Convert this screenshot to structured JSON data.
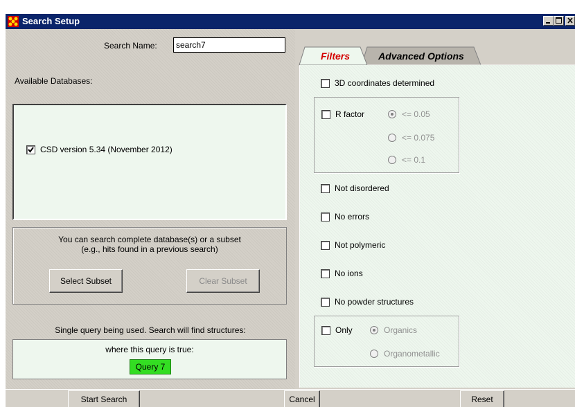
{
  "window": {
    "title": "Search Setup",
    "icon": "app-logo-icon"
  },
  "left": {
    "search_name_label": "Search Name:",
    "search_name_value": "search7",
    "available_databases_label": "Available Databases:",
    "databases": [
      {
        "label": "CSD version 5.34 (November 2012)",
        "checked": true
      }
    ],
    "subset_text_line1": "You can search complete database(s) or a subset",
    "subset_text_line2": "(e.g., hits found in a previous search)",
    "select_subset_label": "Select Subset",
    "clear_subset_label": "Clear Subset",
    "query_info": "Single query being used. Search will find structures:",
    "query_condition": "where this query is true:",
    "query_badge": "Query 7"
  },
  "tabs": {
    "filters": "Filters",
    "advanced": "Advanced Options",
    "active": "Filters"
  },
  "filters": {
    "coords_3d": "3D coordinates determined",
    "r_factor": "R factor",
    "r_options": [
      "<= 0.05",
      "<= 0.075",
      "<= 0.1"
    ],
    "r_selected": "<= 0.05",
    "not_disordered": "Not disordered",
    "no_errors": "No errors",
    "not_polymeric": "Not polymeric",
    "no_ions": "No ions",
    "no_powder": "No powder structures",
    "only": "Only",
    "only_options": [
      "Organics",
      "Organometallic"
    ],
    "only_selected": "Organics"
  },
  "bottom": {
    "start_search": "Start Search",
    "cancel": "Cancel",
    "reset": "Reset"
  },
  "colors": {
    "titlebar": "#0a246a",
    "query_badge": "#33dd22",
    "active_tab_text": "#d40000",
    "panel_bg": "#eef7ee"
  }
}
